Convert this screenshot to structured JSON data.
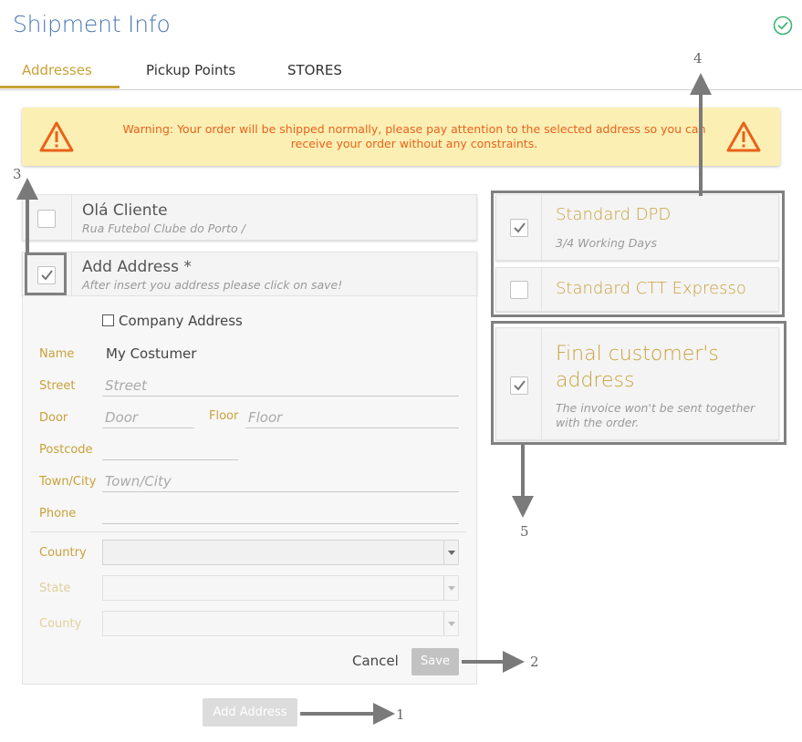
{
  "header": {
    "title": "Shipment Info"
  },
  "tabs": [
    {
      "label": "Addresses",
      "active": true
    },
    {
      "label": "Pickup Points",
      "active": false
    },
    {
      "label": "STORES",
      "active": false
    }
  ],
  "warning": {
    "text": "Warning: Your order will be shipped normally, please pay attention to the selected address so you can receive your order without any constraints.",
    "icon": "warning-triangle-icon",
    "color": "#e8631a"
  },
  "addresses": [
    {
      "name": "Olá Cliente",
      "detail": "Rua Futebol Clube do Porto /",
      "checked": false
    },
    {
      "name": "Add Address *",
      "detail": "After insert you address please click on save!",
      "checked": true
    }
  ],
  "form": {
    "company_label": "Company Address",
    "name_label": "Name",
    "name_value": "My Costumer",
    "street_label": "Street",
    "street_placeholder": "Street",
    "door_label": "Door",
    "door_placeholder": "Door",
    "floor_label": "Floor",
    "floor_placeholder": "Floor",
    "postcode_label": "Postcode",
    "town_label": "Town/City",
    "town_placeholder": "Town/City",
    "phone_label": "Phone",
    "country_label": "Country",
    "state_label": "State",
    "county_label": "County",
    "cancel_label": "Cancel",
    "save_label": "Save"
  },
  "add_address_button": "Add Address",
  "shipping_methods": [
    {
      "name": "Standard DPD",
      "detail": "3/4 Working Days",
      "checked": true
    },
    {
      "name": "Standard CTT Expresso",
      "checked": false
    }
  ],
  "final_customer": {
    "name": "Final customer's address",
    "detail": "The invoice won't be sent together with the order.",
    "checked": true
  },
  "annotations": [
    "1",
    "2",
    "3",
    "4",
    "5"
  ],
  "colors": {
    "accent": "#c9a13a",
    "title": "#4a78b5",
    "success": "#3cb371",
    "warning_bg": "#fcefb4"
  }
}
